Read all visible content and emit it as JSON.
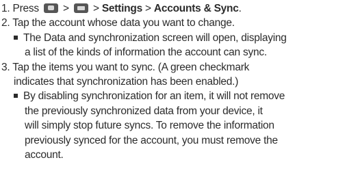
{
  "step1": {
    "number": "1.",
    "press": "Press",
    "sep": ">",
    "settings": "Settings",
    "accounts": "Accounts & Sync",
    "end": ".",
    "icons": [
      "home-key-icon",
      "menu-key-icon"
    ]
  },
  "step2": {
    "number": "2.",
    "text": "Tap the account whose data you want to change."
  },
  "bullet1": {
    "lines": [
      "The Data and synchronization screen will open, displaying",
      "a list of the kinds of information the account can sync."
    ]
  },
  "step3": {
    "number": "3.",
    "lines": [
      "Tap the items you want to sync. (A green checkmark",
      "indicates that synchronization has been enabled.)"
    ]
  },
  "bullet2": {
    "lines": [
      "By disabling synchronization for an item, it will not remove",
      "the previously synchronized data from your device, it",
      "will simply stop future syncs. To remove the information",
      "previously synced for the account, you must remove the",
      "account."
    ]
  }
}
